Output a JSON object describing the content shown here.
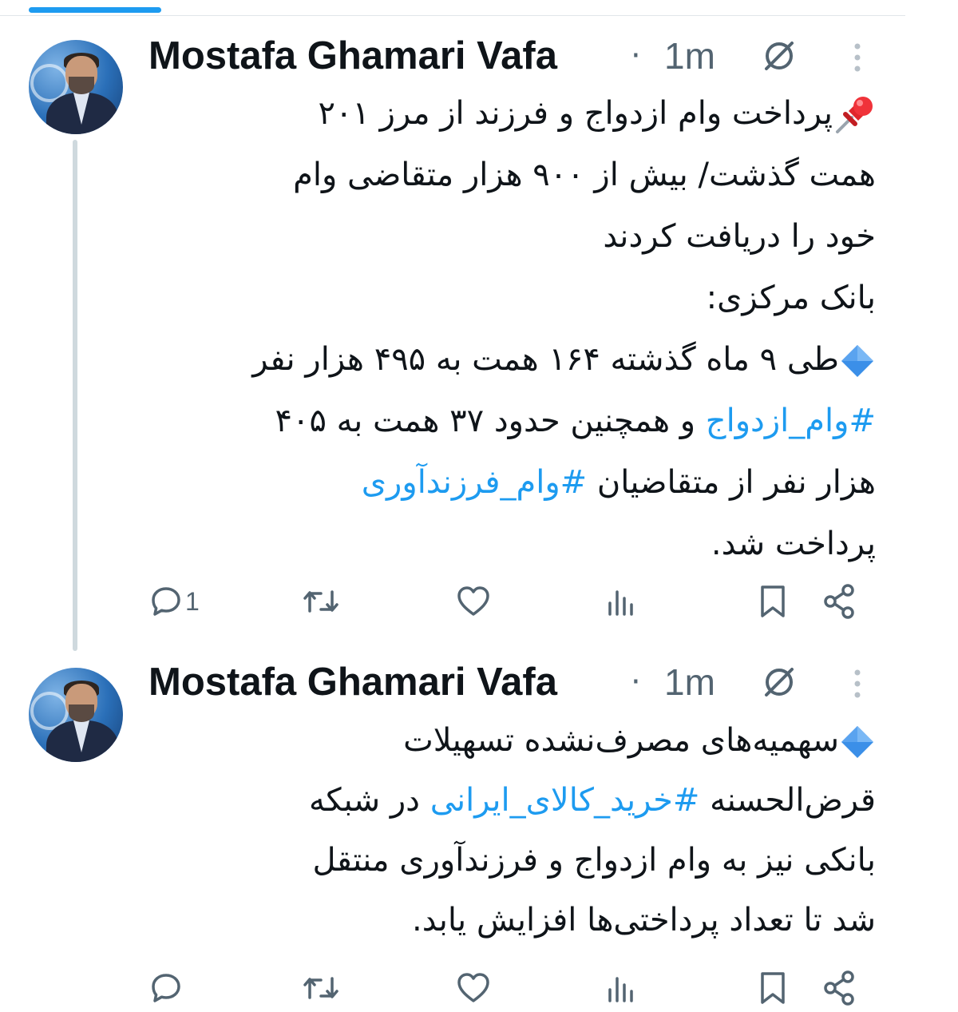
{
  "tweets": [
    {
      "author": "Mostafa Ghamari Vafa",
      "separator": "·",
      "time": "1m",
      "lines": [
        [
          {
            "emoji": "pushpin"
          },
          {
            "text": "پرداخت وام ازدواج و فرزند از مرز ۲۰۱"
          }
        ],
        [
          {
            "text": "همت گذشت/ بیش از ۹۰۰ هزار متقاضی وام"
          }
        ],
        [
          {
            "text": "خود را دریافت کردند"
          }
        ],
        [
          {
            "text": "بانک مرکزی:"
          }
        ],
        [
          {
            "emoji": "diamond"
          },
          {
            "text": "طی ۹ ماه گذشته ۱۶۴ همت به ۴۹۵ هزار نفر"
          }
        ],
        [
          {
            "hashtag": "#وام_ازدواج"
          },
          {
            "text": " و همچنین حدود ۳۷ همت به ۴۰۵"
          }
        ],
        [
          {
            "text": "هزار نفر از متقاضیان "
          },
          {
            "hashtag": "#وام_فرزندآوری"
          }
        ],
        [
          {
            "text": "پرداخت شد."
          }
        ]
      ],
      "actions": {
        "reply_count": "1",
        "retweet_count": "",
        "like_count": "",
        "views_count": ""
      }
    },
    {
      "author": "Mostafa Ghamari Vafa",
      "separator": "·",
      "time": "1m",
      "lines": [
        [
          {
            "emoji": "diamond"
          },
          {
            "text": "سهمیه‌های مصرف‌نشده تسهیلات"
          }
        ],
        [
          {
            "text": "قرض‌الحسنه "
          },
          {
            "hashtag": "#خرید_کالای_ایرانی"
          },
          {
            "text": " در شبکه"
          }
        ],
        [
          {
            "text": "بانکی نیز به وام ازدواج و فرزندآوری منتقل"
          }
        ],
        [
          {
            "text": "شد تا تعداد پرداختی‌ها افزایش یابد."
          }
        ]
      ],
      "actions": {
        "reply_count": "",
        "retweet_count": "",
        "like_count": "",
        "views_count": ""
      }
    }
  ],
  "icons": {
    "header": [
      "grok-icon",
      "more-icon"
    ],
    "actions": [
      "reply-icon",
      "retweet-icon",
      "like-icon",
      "views-icon",
      "bookmark-icon",
      "share-icon"
    ],
    "emoji": {
      "pushpin": "pushpin-emoji-icon",
      "diamond": "blue-diamond-emoji-icon"
    }
  },
  "colors": {
    "text": "#0f1419",
    "secondary": "#536471",
    "link": "#1d9bf0",
    "thread_line": "#cfd9de"
  }
}
